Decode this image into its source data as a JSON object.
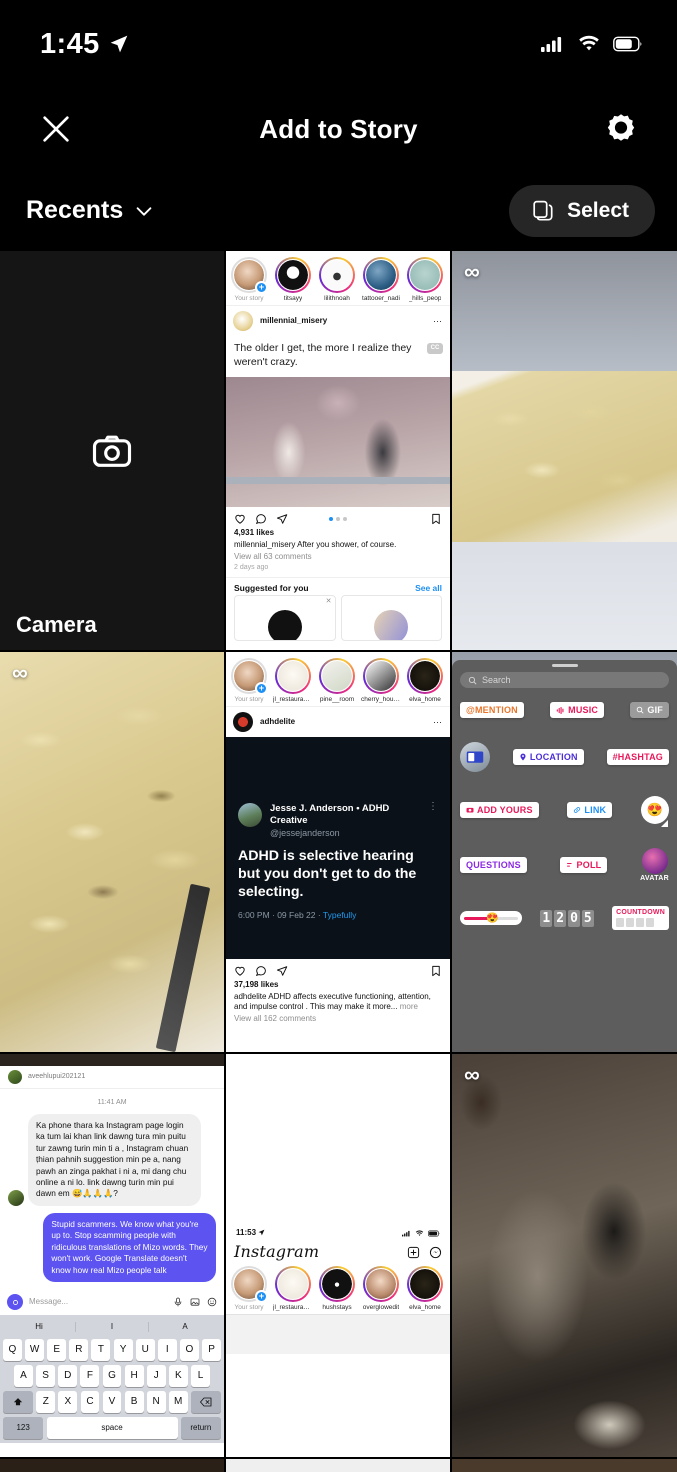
{
  "status_bar": {
    "time": "1:45",
    "location_icon": "location-arrow-icon",
    "cellular_icon": "cellular-bars-icon",
    "wifi_icon": "wifi-icon",
    "battery_icon": "battery-icon"
  },
  "nav": {
    "close_icon": "close-x-icon",
    "title": "Add to Story",
    "settings_icon": "gear-icon"
  },
  "toolbar": {
    "album_label": "Recents",
    "chevron_icon": "chevron-down-icon",
    "select_icon": "multi-select-icon",
    "select_label": "Select"
  },
  "gallery": {
    "camera": {
      "label": "Camera",
      "icon": "camera-icon"
    },
    "boomerang_badge": "∞",
    "cells": [
      {
        "name": "camera-tile",
        "type": "camera"
      },
      {
        "name": "instagram-feed-millennial-misery",
        "type": "screenshot-feed-light"
      },
      {
        "name": "noodles-boomerang-gray",
        "type": "photo-noodle-gray"
      },
      {
        "name": "noodles-boomerang-full",
        "type": "photo-noodle-full"
      },
      {
        "name": "instagram-feed-adhdelite",
        "type": "screenshot-feed-dark"
      },
      {
        "name": "story-sticker-tray",
        "type": "screenshot-sticker-tray"
      },
      {
        "name": "instagram-dm-conversation",
        "type": "screenshot-dm"
      },
      {
        "name": "instagram-home-blank",
        "type": "screenshot-home"
      },
      {
        "name": "cat-boomerang",
        "type": "photo-cat"
      }
    ]
  },
  "cell_feed_light": {
    "stories": [
      {
        "username": "Your story",
        "muted": true,
        "has_plus": true
      },
      {
        "username": "titsayy"
      },
      {
        "username": "lilithnoah"
      },
      {
        "username": "tattooer_nadi"
      },
      {
        "username": "_hills_peop"
      }
    ],
    "post": {
      "account": "millennial_misery",
      "menu_icon": "kebab-menu-icon",
      "caption_overlay": "The older I get, the more I realize they weren't crazy.",
      "cc_badge": "CC",
      "like_icon": "heart-icon",
      "comment_icon": "comment-icon",
      "share_icon": "share-icon",
      "save_icon": "bookmark-icon",
      "likes": "4,931 likes",
      "caption": "millennial_misery After you shower, of course.",
      "view_comments": "View all 63 comments",
      "timestamp": "2 days ago"
    },
    "suggested": {
      "title": "Suggested for you",
      "see_all": "See all",
      "close_icon": "close-x-icon"
    }
  },
  "cell_feed_dark": {
    "stories": [
      {
        "username": "Your story",
        "muted": true,
        "has_plus": true
      },
      {
        "username": "jl_restaurant..."
      },
      {
        "username": "pine__room"
      },
      {
        "username": "cherry_hous..."
      },
      {
        "username": "elva_home"
      }
    ],
    "post": {
      "account": "adhdelite",
      "menu_icon": "kebab-menu-icon",
      "tweet_name": "Jesse J. Anderson • ADHD Creative",
      "tweet_handle": "@jessejanderson",
      "tweet_kebab": "kebab-menu-icon",
      "tweet_body": "ADHD is selective hearing but you don't get to do the selecting.",
      "tweet_meta_time": "6:00 PM · 09 Feb 22 · ",
      "tweet_meta_source": "Typefully",
      "like_icon": "heart-icon",
      "comment_icon": "comment-icon",
      "share_icon": "share-icon",
      "save_icon": "bookmark-icon",
      "likes": "37,198 likes",
      "caption": "adhdelite ADHD affects executive functioning, attention, and impulse control . This may make it more...",
      "more_label": "more",
      "view_comments": "View all 162 comments"
    }
  },
  "cell_sticker_tray": {
    "search_placeholder": "Search",
    "search_icon": "search-icon",
    "grabber": "drag-handle",
    "stickers": [
      {
        "label": "@MENTION",
        "kind": "mention"
      },
      {
        "label": "MUSIC",
        "kind": "music"
      },
      {
        "label": "GIF",
        "kind": "gif"
      },
      {
        "label": "",
        "kind": "photo"
      },
      {
        "label": "LOCATION",
        "kind": "location"
      },
      {
        "label": "#HASHTAG",
        "kind": "hashtag"
      },
      {
        "label": "ADD YOURS",
        "kind": "addyours"
      },
      {
        "label": "LINK",
        "kind": "link"
      },
      {
        "label": "😍",
        "kind": "emoji-reaction"
      },
      {
        "label": "QUESTIONS",
        "kind": "questions"
      },
      {
        "label": "POLL",
        "kind": "poll"
      },
      {
        "label": "AVATAR",
        "kind": "avatar"
      },
      {
        "label": "",
        "kind": "emoji-slider"
      },
      {
        "label": "1205",
        "kind": "clock"
      },
      {
        "label": "COUNTDOWN",
        "kind": "countdown"
      }
    ],
    "clock_digits": [
      "1",
      "2",
      "0",
      "5"
    ],
    "countdown_label": "COUNTDOWN",
    "slider_emoji": "😍"
  },
  "cell_dm": {
    "account": "aveehlupui202121",
    "time_divider": "11:41 AM",
    "messages": [
      {
        "from": "them",
        "text": "Ka phone thara ka Instagram page login ka tum lai khan link dawng tura min puitu tur zawng turin min ti a , Instagram chuan ṭhian pahnih suggestion min pe a, nang pawh an zinga pakhat i ni a, mi dang chu online a ni lo. link dawng turin min pui dawn em 😅🙏🙏🙏?"
      },
      {
        "from": "me",
        "text": "Stupid scammers. We know what you're up to. Stop scamming people with ridiculous translations of Mizo words. They won't work. Google Translate doesn't know how real Mizo people talk"
      }
    ],
    "input_placeholder": "Message...",
    "input_camera_icon": "camera-icon",
    "mic_icon": "microphone-icon",
    "gallery_icon": "photo-icon",
    "sticker_icon": "sticker-icon",
    "keyboard": {
      "predictions": [
        "Hi",
        "I",
        "A"
      ],
      "row1": [
        "Q",
        "W",
        "E",
        "R",
        "T",
        "Y",
        "U",
        "I",
        "O",
        "P"
      ],
      "row2": [
        "A",
        "S",
        "D",
        "F",
        "G",
        "H",
        "J",
        "K",
        "L"
      ],
      "row3": [
        "Z",
        "X",
        "C",
        "V",
        "B",
        "N",
        "M"
      ],
      "shift_icon": "shift-icon",
      "backspace_icon": "backspace-icon",
      "numbers_key": "123",
      "space_key": "space",
      "return_key": "return"
    }
  },
  "cell_home": {
    "status_time": "11:53",
    "location_icon": "location-arrow-icon",
    "cellular_icon": "cellular-bars-icon",
    "wifi_icon": "wifi-icon",
    "battery_icon": "battery-icon",
    "logo": "Instagram",
    "new_post_icon": "plus-box-icon",
    "messenger_icon": "messenger-icon",
    "stories": [
      {
        "username": "Your story",
        "muted": true,
        "has_plus": true
      },
      {
        "username": "jl_restaurant..."
      },
      {
        "username": "hushstays"
      },
      {
        "username": "overglowedit"
      },
      {
        "username": "elva_home"
      }
    ]
  },
  "colors": {
    "background": "#000000",
    "accent_blue": "#1d90f5",
    "pill_bg": "#262626",
    "dm_bubble_me": "#5c53f0",
    "tray_bg": "#5d5d5d"
  }
}
